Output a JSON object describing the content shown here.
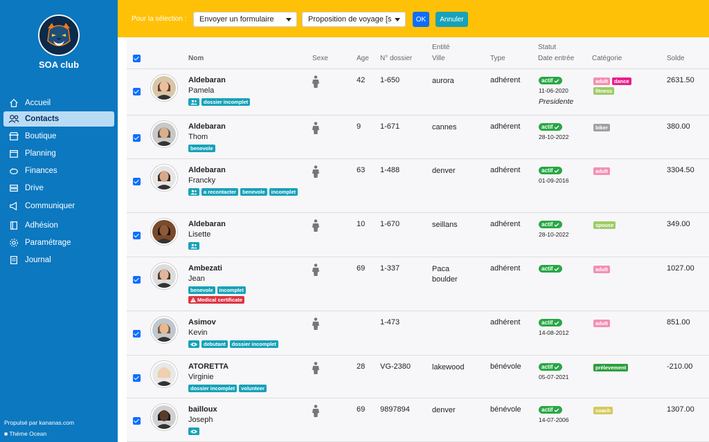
{
  "brand": "SOA club",
  "logo": {
    "desc": "bear-logo"
  },
  "nav": [
    {
      "label": "Accueil",
      "icon": "home-icon"
    },
    {
      "label": "Contacts",
      "icon": "users-icon",
      "active": true
    },
    {
      "label": "Boutique",
      "icon": "shop-icon"
    },
    {
      "label": "Planning",
      "icon": "calendar-icon"
    },
    {
      "label": "Finances",
      "icon": "piggy-bank-icon"
    },
    {
      "label": "Drive",
      "icon": "drive-icon"
    },
    {
      "label": "Communiquer",
      "icon": "megaphone-icon"
    },
    {
      "label": "Adhésion",
      "icon": "card-icon"
    },
    {
      "label": "Paramétrage",
      "icon": "gear-icon"
    },
    {
      "label": "Journal",
      "icon": "journal-icon"
    }
  ],
  "footer": {
    "powered": "Propulsé par kananas.com",
    "theme": "Thème Ocean"
  },
  "toolbar": {
    "label": "Pour la sélection :",
    "action_select": "Envoyer un formulaire",
    "form_select": "Proposition de voyage [s",
    "ok": "OK",
    "cancel": "Annuler"
  },
  "headers": {
    "nom": "Nom",
    "sexe": "Sexe",
    "age": "Age",
    "dossier": "N° dossier",
    "entite": "Entité",
    "ville": "Ville",
    "type": "Type",
    "statut": "Statut",
    "date_entree": "Date entrée",
    "categorie": "Catégorie",
    "solde": "Solde"
  },
  "colors": {
    "sidebar": "#0b78c0",
    "topbar": "#ffc107",
    "ok": "#0d6efd",
    "cancel": "#17a2b8",
    "tag": "#17a2b8",
    "actif": "#28a745"
  },
  "rows": [
    {
      "last": "Aldebaran",
      "first": "Pamela",
      "age": "42",
      "dossier": "1-650",
      "ville": "aurora",
      "type": "adhérent",
      "statut": "actif",
      "date": "11-06-2020",
      "role": "Presidente",
      "solde": "2631.50",
      "tags": [
        {
          "icon": "group-icon"
        },
        {
          "text": "dossier incomplet"
        }
      ],
      "cats": [
        {
          "text": "adult",
          "color": "#f48fb1"
        },
        {
          "text": "dance",
          "color": "#e91e8c"
        },
        {
          "text": "fitness",
          "color": "#9ccc65"
        }
      ]
    },
    {
      "last": "Aldebaran",
      "first": "Thom",
      "age": "9",
      "dossier": "1-671",
      "ville": "cannes",
      "type": "adhérent",
      "statut": "actif",
      "date": "28-10-2022",
      "role": "",
      "solde": "380.00",
      "tags": [
        {
          "text": "benevole"
        }
      ],
      "cats": [
        {
          "text": "biker",
          "color": "#a0a0a0"
        }
      ]
    },
    {
      "last": "Aldebaran",
      "first": "Francky",
      "age": "63",
      "dossier": "1-488",
      "ville": "denver",
      "type": "adhérent",
      "statut": "actif",
      "date": "01-09-2016",
      "role": "",
      "solde": "3304.50",
      "tags": [
        {
          "icon": "group-icon"
        },
        {
          "text": "a recontacter"
        },
        {
          "text": "benevole"
        },
        {
          "text": "incomplet"
        }
      ],
      "cats": [
        {
          "text": "adult",
          "color": "#f48fb1"
        }
      ]
    },
    {
      "last": "Aldebaran",
      "first": "Lisette",
      "age": "10",
      "dossier": "1-670",
      "ville": "seillans",
      "type": "adhérent",
      "statut": "actif",
      "date": "28-10-2022",
      "role": "",
      "solde": "349.00",
      "tags": [
        {
          "icon": "group-icon"
        }
      ],
      "cats": [
        {
          "text": "spouse",
          "color": "#9ccc65"
        }
      ]
    },
    {
      "last": "Ambezati",
      "first": "Jean",
      "age": "69",
      "dossier": "1-337",
      "ville": "Paca boulder",
      "type": "adhérent",
      "statut": "actif",
      "date": "",
      "role": "",
      "solde": "1027.00",
      "tags": [
        {
          "text": "benevole"
        },
        {
          "text": "incomplet"
        },
        {
          "text": "Medical certificate",
          "red": true
        }
      ],
      "cats": [
        {
          "text": "adult",
          "color": "#f48fb1"
        }
      ]
    },
    {
      "last": "Asimov",
      "first": "Kevin",
      "age": "",
      "dossier": "1-473",
      "ville": "",
      "type": "adhérent",
      "statut": "actif",
      "date": "14-08-2012",
      "role": "",
      "solde": "851.00",
      "tags": [
        {
          "icon": "eye-icon"
        },
        {
          "text": "debutant"
        },
        {
          "text": "dossier incomplet"
        }
      ],
      "cats": [
        {
          "text": "adult",
          "color": "#f48fb1"
        }
      ]
    },
    {
      "last": "ATORETTA",
      "first": "Virginie",
      "age": "28",
      "dossier": "VG-2380",
      "ville": "lakewood",
      "type": "bénévole",
      "statut": "actif",
      "date": "05-07-2021",
      "role": "",
      "solde": "-210.00",
      "tags": [
        {
          "text": "dossier incomplet"
        },
        {
          "text": "volunteer"
        }
      ],
      "cats": [
        {
          "text": "prélevement",
          "color": "#2e9e3e"
        }
      ]
    },
    {
      "last": "bailloux",
      "first": "Joseph",
      "age": "69",
      "dossier": "9897894",
      "ville": "denver",
      "type": "bénévole",
      "statut": "actif",
      "date": "14-07-2006",
      "role": "",
      "solde": "1307.00",
      "tags": [
        {
          "icon": "eye-icon"
        }
      ],
      "cats": [
        {
          "text": "coach",
          "color": "#d4c95a"
        }
      ]
    }
  ]
}
